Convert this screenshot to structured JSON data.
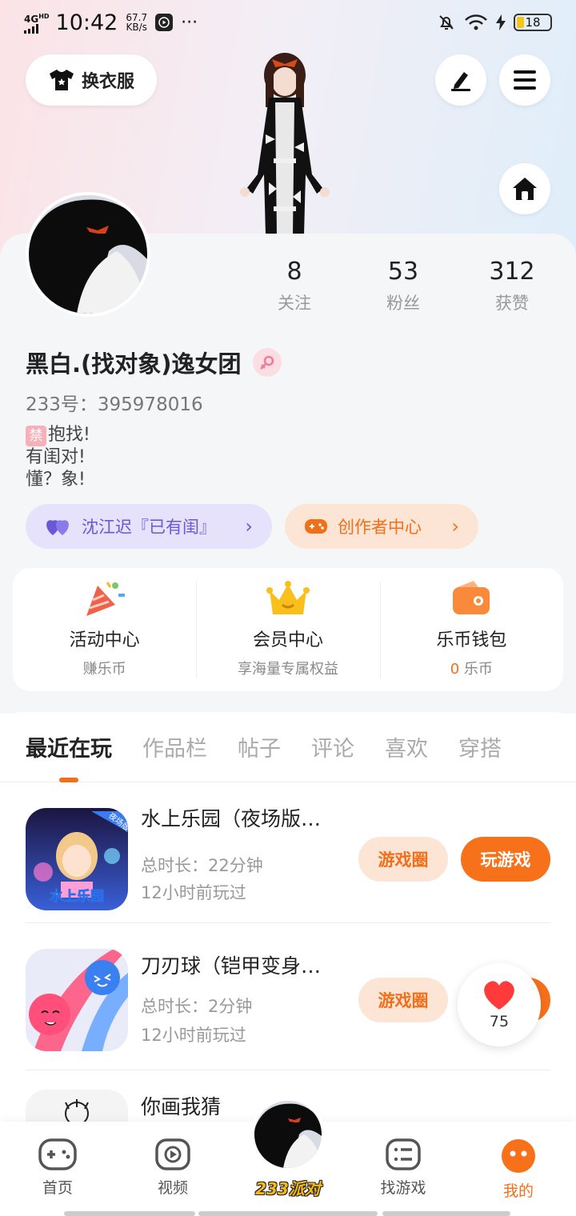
{
  "status_bar": {
    "network": "4G",
    "network_sup": "HD",
    "time": "10:42",
    "speed_value": "67.7",
    "speed_unit": "KB/s",
    "more": "···",
    "battery": "18"
  },
  "header": {
    "change_outfit_label": "换衣服"
  },
  "profile": {
    "stats": [
      {
        "num": "8",
        "label": "关注"
      },
      {
        "num": "53",
        "label": "粉丝"
      },
      {
        "num": "312",
        "label": "获赞"
      }
    ],
    "username": "黑白.(找对象)逸女团",
    "uid": "233号：395978016",
    "bio_tag": "禁",
    "bio_line1": "抱找!",
    "bio_line2": "有闺对!",
    "bio_line3": "懂？象!",
    "tag_relation": "沈江迟『已有闺』",
    "tag_creator": "创作者中心"
  },
  "quick_panel": {
    "items": [
      {
        "title": "活动中心",
        "sub": "赚乐币"
      },
      {
        "title": "会员中心",
        "sub": "享海量专属权益"
      },
      {
        "title": "乐币钱包",
        "sub_value": "0",
        "sub_unit": "乐币"
      }
    ]
  },
  "tabs": [
    "最近在玩",
    "作品栏",
    "帖子",
    "评论",
    "喜欢",
    "穿搭"
  ],
  "games": [
    {
      "name": "水上乐园（夜场版…",
      "duration": "总时长：22分钟",
      "last_played": "12小时前玩过",
      "icon_badge": "夜场版",
      "icon_text": "水上乐园"
    },
    {
      "name": "刀刃球（铠甲变身…",
      "duration": "总时长：2分钟",
      "last_played": "12小时前玩过"
    },
    {
      "name": "你画我猜"
    }
  ],
  "buttons": {
    "circle": "游戏圈",
    "play": "玩游戏"
  },
  "like_count": "75",
  "bottom_nav": [
    {
      "label": "首页"
    },
    {
      "label": "视频"
    },
    {
      "label": "233派对"
    },
    {
      "label": "找游戏"
    },
    {
      "label": "我的"
    }
  ],
  "colors": {
    "accent": "#f7711a",
    "accent_light": "#fde5d6",
    "purple": "#6a58d6",
    "purple_light": "#e6e2fb"
  }
}
